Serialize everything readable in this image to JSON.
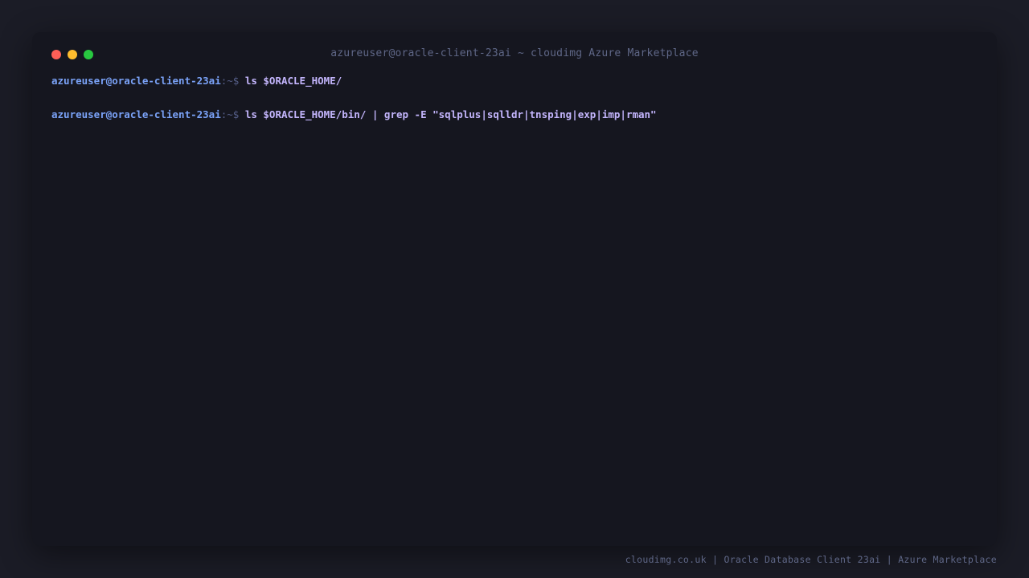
{
  "window": {
    "title": "azureuser@oracle-client-23ai ~ cloudimg Azure Marketplace",
    "controls": {
      "close_color": "#ff5f57",
      "minimize_color": "#febc2e",
      "maximize_color": "#28c840"
    }
  },
  "terminal": {
    "lines": [
      {
        "prompt_user": "azureuser@oracle-client-23ai",
        "prompt_path": ":~$ ",
        "command": "ls $ORACLE_HOME/"
      },
      {
        "prompt_user": "azureuser@oracle-client-23ai",
        "prompt_path": ":~$ ",
        "command": "ls $ORACLE_HOME/bin/ | grep -E \"sqlplus|sqlldr|tnsping|exp|imp|rman\""
      }
    ]
  },
  "footer": {
    "text": "cloudimg.co.uk | Oracle Database Client 23ai | Azure Marketplace"
  }
}
